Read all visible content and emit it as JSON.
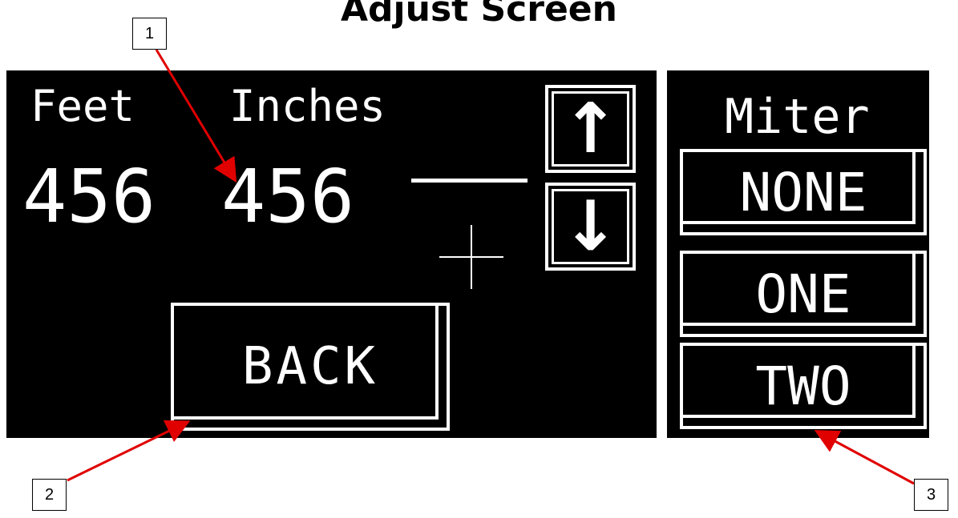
{
  "title": "Adjust Screen",
  "display": {
    "feet_label": "Feet",
    "inches_label": "Inches",
    "feet_value": "456",
    "inches_value": "456",
    "up_arrow": "↑",
    "down_arrow": "↓",
    "back_label": "BACK",
    "miter_label": "Miter",
    "miter_options": [
      "NONE",
      "ONE",
      "TWO"
    ]
  },
  "callouts": [
    "1",
    "2",
    "3"
  ],
  "colors": {
    "screen": "#000000",
    "foreground": "#ffffff",
    "arrow": "#e00000"
  }
}
